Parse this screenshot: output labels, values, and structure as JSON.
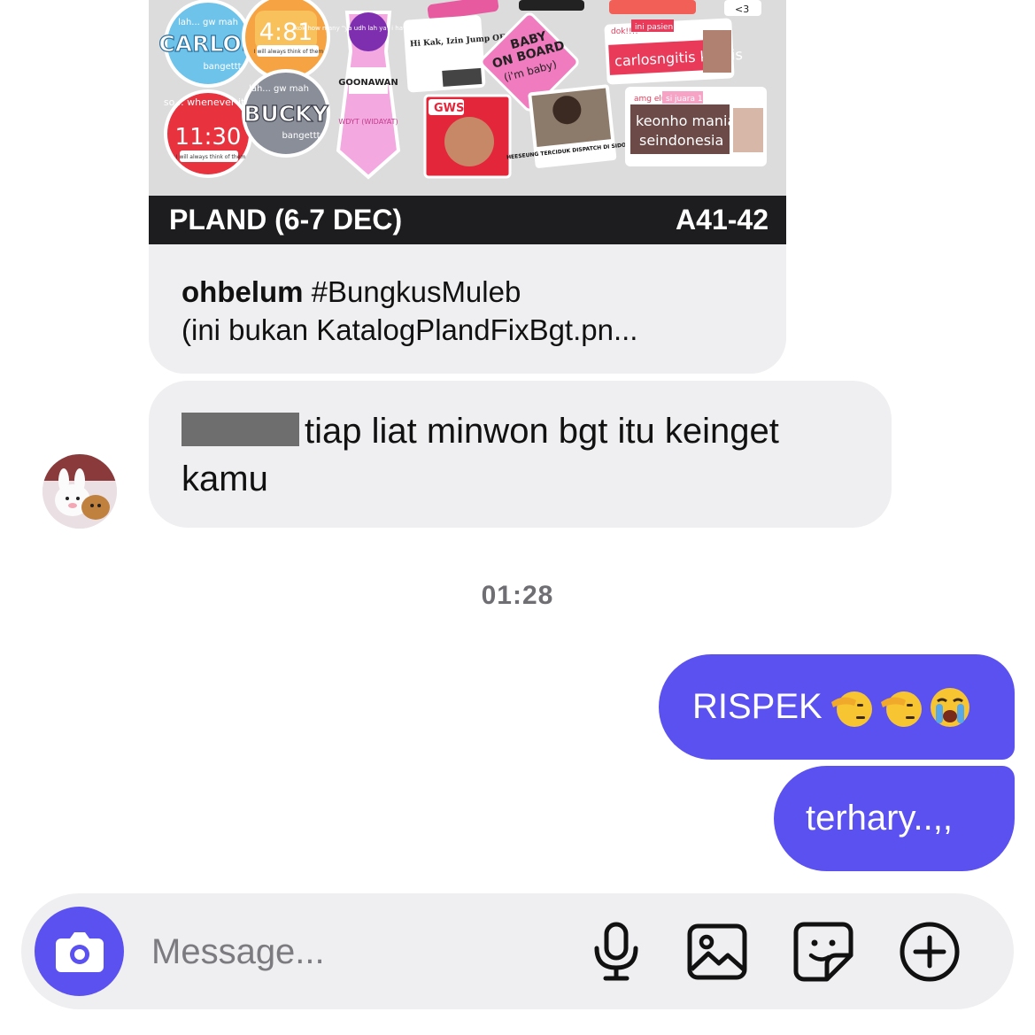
{
  "shared_post": {
    "banner_left": "PLAND (6-7 DEC)",
    "banner_right": "A41-42",
    "username": "ohbelum",
    "caption_line1": "#BungkusMuleb",
    "caption_line2": "(ini bukan KatalogPlandFixBgt.pn...",
    "stickers": {
      "carlos_top": "lah... gw mah",
      "carlos": "CARLOS",
      "carlos_bottom": "bangettt",
      "clock1": "4:81",
      "clock1_note": "I will always think of them",
      "so_whenever": "so... whenever it's",
      "clock2": "11:30",
      "clock2_note": "I will always think of them",
      "bucky_top": "lah... gw mah",
      "bucky": "BUCKY",
      "bucky_bottom": "bangettt",
      "tie_top": "kok how many \"ya udh lah ya\" i have left in me",
      "tie_name": "GOONAWAN",
      "tie_bottom": "WDYT (WIDAYAT)",
      "hi_kak": "Hi Kak, Izin Jump OFF ya",
      "baby": "BABY",
      "on_board": "ON BOARD",
      "im_baby": "(i'm baby)",
      "gws": "GWS",
      "dispatch": "HEESEUNG TERCIDUK DISPATCH DI SIDOARJO!",
      "dok": "dok!!!!",
      "ini_pasien": "ini pasien",
      "carlosngitis": "carlosngitis kronis",
      "amg_elu": "amg elu",
      "si_juara": "si juara 1",
      "keonho": "keonho mania",
      "seindonesia": "seindonesia",
      "heart": "<3"
    }
  },
  "incoming_message": {
    "text_line1": "tiap liat minwon bgt itu keinget",
    "text_line2": "kamu"
  },
  "timestamp": "01:28",
  "outgoing_messages": {
    "first_text": "RISPEK",
    "first_emojis": [
      "saluting-face",
      "saluting-face",
      "loudly-crying-face"
    ],
    "second_text": "terhary..,,"
  },
  "composer": {
    "placeholder": "Message..."
  },
  "colors": {
    "accent": "#5b51f0",
    "bubble_in": "#efeff1"
  }
}
